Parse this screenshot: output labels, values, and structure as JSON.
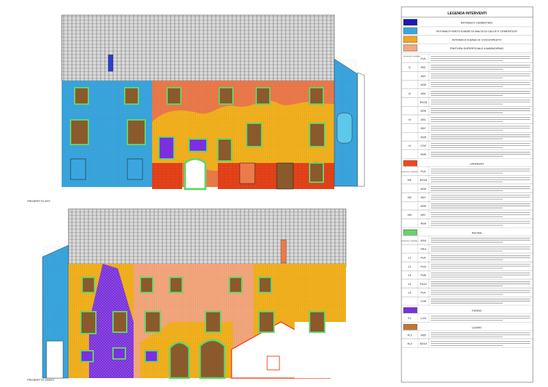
{
  "elevations": {
    "top_caption": "PROSPETTO EST",
    "bottom_caption": "PROSPETTO OVEST"
  },
  "legend": {
    "title": "LEGENDA INTERVENTI",
    "finishes": [
      {
        "label": "INTONACO CEMENTIZIO",
        "color": "#1a1ab5"
      },
      {
        "label": "INTONACO MISTO A BASE DI MALTA DI CALCE E CEMENTIZIO",
        "color": "#3aa6df"
      },
      {
        "label": "INTONACO A BASE DI COCCIOPESTO",
        "color": "#f3a521"
      },
      {
        "label": "FINITURA SUPERFICIALE A MARMORINO",
        "color": "#f5a77d"
      }
    ],
    "header_left": "INTERVENTI GENERALI",
    "sections": [
      {
        "name": "",
        "color": "",
        "rows": [
          {
            "code": "",
            "sub": "PU1"
          },
          {
            "code": "I1",
            "sub": "AS1"
          },
          {
            "code": "",
            "sub": "AS7"
          },
          {
            "code": "",
            "sub": "AG6"
          },
          {
            "code": "I2",
            "sub": "AS1"
          },
          {
            "code": "",
            "sub": "AG18"
          },
          {
            "code": "",
            "sub": "AG6"
          },
          {
            "code": "I3",
            "sub": "AS1"
          },
          {
            "code": "",
            "sub": "AS7"
          },
          {
            "code": "",
            "sub": "AG6"
          },
          {
            "code": "I4",
            "sub": "CO2"
          },
          {
            "code": "",
            "sub": "AG6"
          }
        ]
      },
      {
        "name": "LATERIZIO",
        "color": "#f2461b",
        "rows": [
          {
            "code": "INTERVENTI GENERALI",
            "sub": "PU1"
          },
          {
            "code": "M1",
            "sub": "AG18"
          },
          {
            "code": "",
            "sub": "AG6"
          },
          {
            "code": "M2",
            "sub": "AS7"
          },
          {
            "code": "",
            "sub": "AG6"
          },
          {
            "code": "M3",
            "sub": "AS7"
          },
          {
            "code": "",
            "sub": "AG6"
          }
        ]
      },
      {
        "name": "PIETRA",
        "color": "#62d56a",
        "rows": [
          {
            "code": "INTERVENTI GENERALI",
            "sub": "AG3"
          },
          {
            "code": "",
            "sub": "PR4"
          },
          {
            "code": "L1",
            "sub": "PU1"
          },
          {
            "code": "L2",
            "sub": "PU3"
          },
          {
            "code": "L3",
            "sub": "PU6"
          },
          {
            "code": "L4",
            "sub": "PU12"
          },
          {
            "code": "L5",
            "sub": "PU1"
          },
          {
            "code": "",
            "sub": "CO6"
          }
        ]
      },
      {
        "name": "FERRO",
        "color": "#7c2fe0",
        "rows": [
          {
            "code": "F1",
            "sub": "CO3"
          }
        ]
      },
      {
        "name": "LEGNO",
        "color": "#c4772e",
        "rows": [
          {
            "code": "XL1",
            "sub": "AS5"
          },
          {
            "code": "XL2",
            "sub": "AG14"
          }
        ]
      }
    ]
  }
}
